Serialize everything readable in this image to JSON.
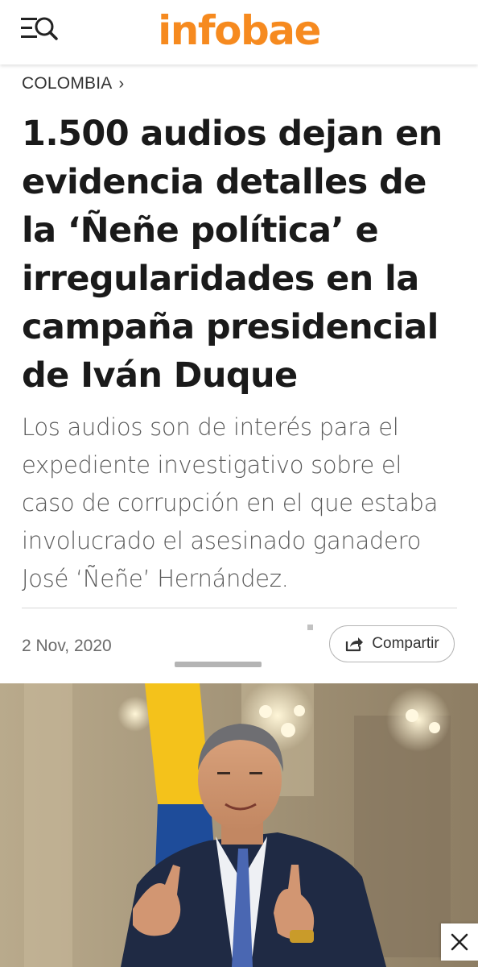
{
  "header": {
    "logo_text": "infobae",
    "menu_icon": "menu-search-icon",
    "brand_color": "#f68a1f"
  },
  "article": {
    "section_label": "COLOMBIA",
    "headline": "1.500 audios dejan en evidencia detalles de la ‘Ñeñe política’ e irregularidades en la campaña presidencial de Iván Duque",
    "subtitle": "Los audios son de interés para el expediente investigativo sobre el caso de corrupción en el que estaba involucrado el asesinado ganadero José ‘Ñeñe’ Hernández.",
    "date": "2 Nov, 2020",
    "share_label": "Compartir",
    "share_icon": "share-arrow-icon"
  },
  "photo": {
    "icon": "article-photo"
  },
  "overlay": {
    "close_icon": "close-icon"
  }
}
